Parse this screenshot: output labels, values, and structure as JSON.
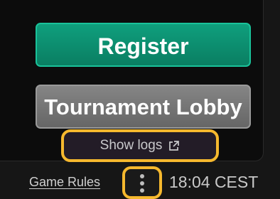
{
  "buttons": {
    "register_label": "Register",
    "lobby_label": "Tournament Lobby"
  },
  "logs": {
    "label": "Show logs",
    "icon": "external-link-icon"
  },
  "footer": {
    "game_rules_label": "Game Rules",
    "menu_icon": "vertical-ellipsis-icon",
    "clock_text": "18:04 CEST"
  },
  "colors": {
    "register_bg": "#0a8a6c",
    "lobby_bg": "#777777",
    "highlight": "#f5b82e"
  }
}
